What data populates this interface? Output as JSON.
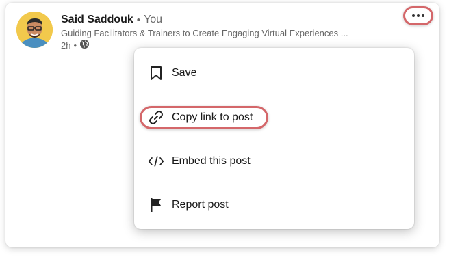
{
  "post": {
    "author_name": "Said Saddouk",
    "separator": "•",
    "relation": "You",
    "headline": "Guiding Facilitators & Trainers to Create Engaging Virtual Experiences ...",
    "time": "2h",
    "meta_separator": "•",
    "visibility_icon": "globe-icon"
  },
  "more_button_icon": "ellipsis-icon",
  "menu": {
    "items": [
      {
        "label": "Save",
        "icon": "bookmark-icon"
      },
      {
        "label": "Copy link to post",
        "icon": "link-icon"
      },
      {
        "label": "Embed this post",
        "icon": "code-icon"
      },
      {
        "label": "Report post",
        "icon": "flag-icon"
      }
    ]
  },
  "colors": {
    "highlight": "#d4676a",
    "avatar_bg": "#f2c94c"
  }
}
